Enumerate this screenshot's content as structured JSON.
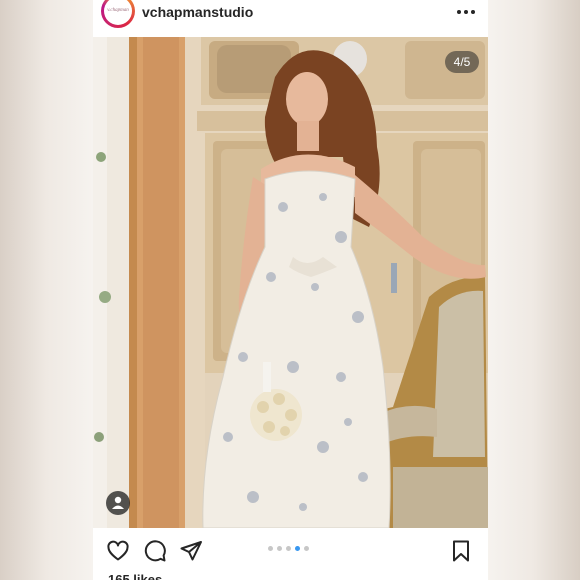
{
  "header": {
    "username": "vchapmanstudio",
    "avatar_text": "v.chapman"
  },
  "photo": {
    "counter": "4/5"
  },
  "carousel": {
    "total": 5,
    "active_index": 4
  },
  "footer": {
    "likes": "165 likes"
  },
  "colors": {
    "accent_dot": "#3897f0",
    "text": "#262626"
  },
  "icons": [
    "more-icon",
    "user-tag-icon",
    "heart-icon",
    "comment-icon",
    "share-icon",
    "bookmark-icon"
  ]
}
